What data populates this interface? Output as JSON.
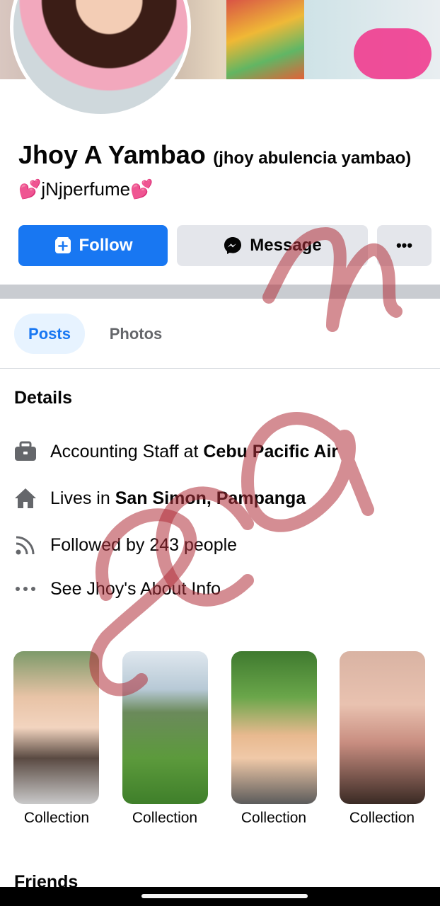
{
  "profile": {
    "name": "Jhoy A Yambao",
    "alternate_name": "(jhoy abulencia yambao)",
    "bio": "💕jNjperfume💕"
  },
  "actions": {
    "follow_label": "Follow",
    "message_label": "Message",
    "more_label": "•••"
  },
  "tabs": [
    {
      "label": "Posts",
      "active": true
    },
    {
      "label": "Photos",
      "active": false
    }
  ],
  "details": {
    "title": "Details",
    "work_prefix": "Accounting Staff at ",
    "work_place": "Cebu Pacific Air",
    "lives_prefix": "Lives in ",
    "lives_place": "San Simon, Pampanga",
    "followers": "Followed by 243 people",
    "about": "See Jhoy's About Info"
  },
  "collections": [
    {
      "label": "Collection"
    },
    {
      "label": "Collection"
    },
    {
      "label": "Collection"
    },
    {
      "label": "Collection"
    }
  ],
  "friends_title": "Friends",
  "overlay_text": "scam",
  "colors": {
    "brand_blue": "#1877f2",
    "secondary_button": "#e4e6eb",
    "active_tab_bg": "#e7f3ff",
    "overlay": "#b0303a"
  }
}
